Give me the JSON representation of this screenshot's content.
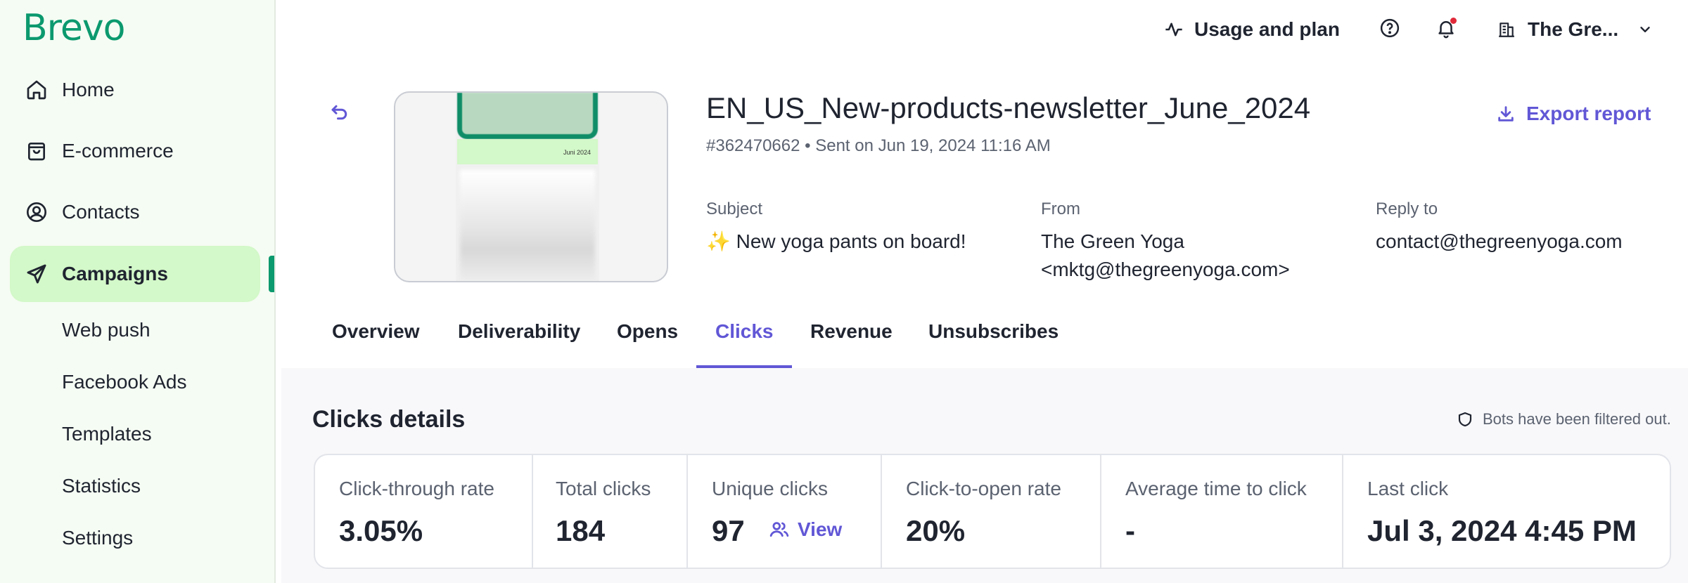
{
  "brand": {
    "logo_text": "Brevo",
    "accent": "#0b996e",
    "active_bg": "#d3f8c9",
    "link_color": "#6157d6"
  },
  "sidebar": {
    "items": [
      {
        "label": "Home",
        "icon": "home-icon"
      },
      {
        "label": "E-commerce",
        "icon": "shopping-bag-icon"
      },
      {
        "label": "Contacts",
        "icon": "user-circle-icon"
      },
      {
        "label": "Campaigns",
        "icon": "send-icon",
        "active": true
      }
    ],
    "sub_items": [
      {
        "label": "Web push"
      },
      {
        "label": "Facebook Ads"
      },
      {
        "label": "Templates"
      },
      {
        "label": "Statistics"
      },
      {
        "label": "Settings"
      }
    ]
  },
  "topbar": {
    "usage_label": "Usage and plan",
    "account_label": "The Gre..."
  },
  "campaign": {
    "title": "EN_US_New-products-newsletter_June_2024",
    "meta": "#362470662 • Sent on Jun 19, 2024 11:16 AM",
    "thumbnail_text": "Juni 2024",
    "export_label": "Export report",
    "subject_label": "Subject",
    "subject_value": "✨ New yoga pants on board!",
    "from_label": "From",
    "from_name": "The Green Yoga",
    "from_email": "<mktg@thegreenyoga.com>",
    "reply_label": "Reply to",
    "reply_value": "contact@thegreenyoga.com"
  },
  "tabs": [
    {
      "label": "Overview"
    },
    {
      "label": "Deliverability"
    },
    {
      "label": "Opens"
    },
    {
      "label": "Clicks",
      "active": true
    },
    {
      "label": "Revenue"
    },
    {
      "label": "Unsubscribes"
    }
  ],
  "details": {
    "title": "Clicks details",
    "bots_note": "Bots have been filtered out.",
    "stats": [
      {
        "label": "Click-through rate",
        "value": "3.05%"
      },
      {
        "label": "Total clicks",
        "value": "184"
      },
      {
        "label": "Unique clicks",
        "value": "97",
        "link": "View"
      },
      {
        "label": "Click-to-open rate",
        "value": "20%"
      },
      {
        "label": "Average time to click",
        "value": "-"
      },
      {
        "label": "Last click",
        "value": "Jul 3, 2024 4:45 PM"
      }
    ]
  }
}
